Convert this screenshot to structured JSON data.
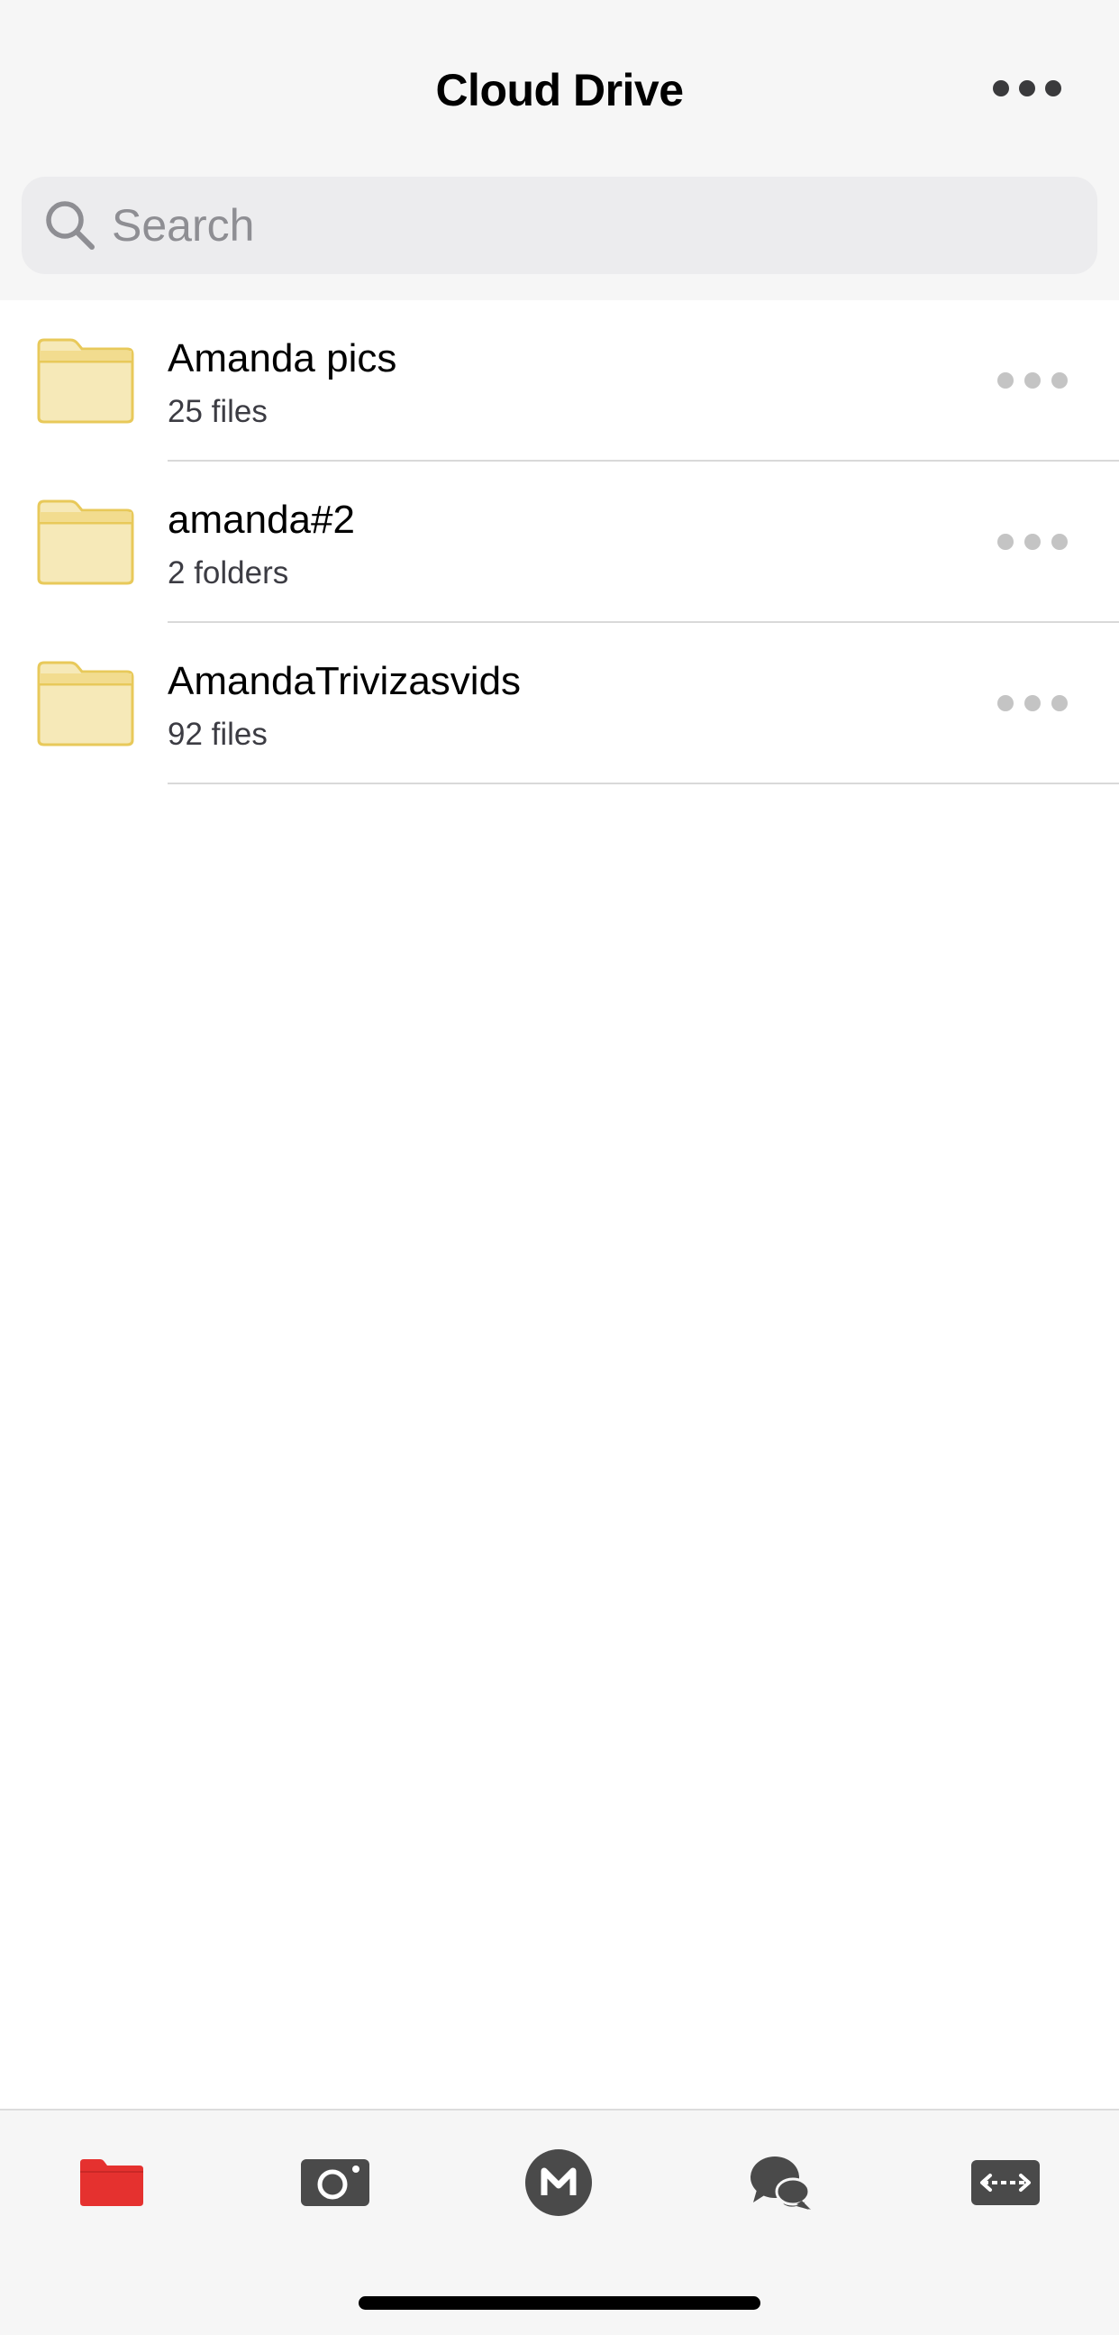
{
  "header": {
    "title": "Cloud Drive",
    "more_icon": "ellipsis-horizontal-icon"
  },
  "search": {
    "placeholder": "Search",
    "value": "",
    "icon": "search-icon"
  },
  "files": [
    {
      "name": "Amanda pics",
      "meta": "25 files",
      "icon": "folder-icon",
      "more_icon": "ellipsis-horizontal-icon"
    },
    {
      "name": "amanda#2",
      "meta": "2 folders",
      "icon": "folder-icon",
      "more_icon": "ellipsis-horizontal-icon"
    },
    {
      "name": "AmandaTrivizasvids",
      "meta": "92 files",
      "icon": "folder-icon",
      "more_icon": "ellipsis-horizontal-icon"
    }
  ],
  "tabs": [
    {
      "id": "cloud-drive",
      "icon": "folder-filled-icon",
      "active": true
    },
    {
      "id": "camera-uploads",
      "icon": "camera-icon",
      "active": false
    },
    {
      "id": "home",
      "icon": "mega-logo-icon",
      "active": false
    },
    {
      "id": "chat",
      "icon": "chat-bubbles-icon",
      "active": false
    },
    {
      "id": "transfers",
      "icon": "transfer-arrows-icon",
      "active": false
    }
  ],
  "colors": {
    "accent": "#e5312f",
    "folder_fill": "#f6e9b8",
    "folder_stroke": "#e8c95a",
    "tab_icon": "#4a4a4a",
    "row_more_dots": "#c4c4c4"
  }
}
